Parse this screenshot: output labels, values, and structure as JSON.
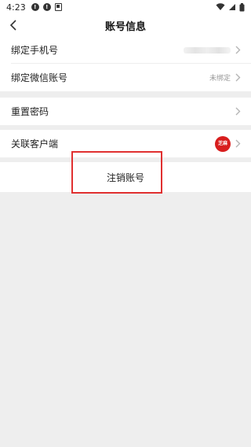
{
  "status_bar": {
    "time": "4:23",
    "icons": [
      "alert-circle-icon",
      "alert-circle-icon",
      "sim-card-icon"
    ],
    "right_icons": [
      "wifi-icon",
      "signal-icon",
      "battery-icon"
    ]
  },
  "header": {
    "title": "账号信息"
  },
  "rows": {
    "bind_phone": {
      "label": "绑定手机号",
      "value": ""
    },
    "bind_wechat": {
      "label": "绑定微信账号",
      "value": "未绑定"
    },
    "reset_password": {
      "label": "重置密码"
    },
    "linked_client": {
      "label": "关联客户端",
      "avatar_text": "芝麻"
    }
  },
  "cancel_account": {
    "label": "注销账号"
  },
  "colors": {
    "accent_red": "#e03030",
    "avatar_red": "#d81e1e",
    "background": "#eeeeee"
  }
}
